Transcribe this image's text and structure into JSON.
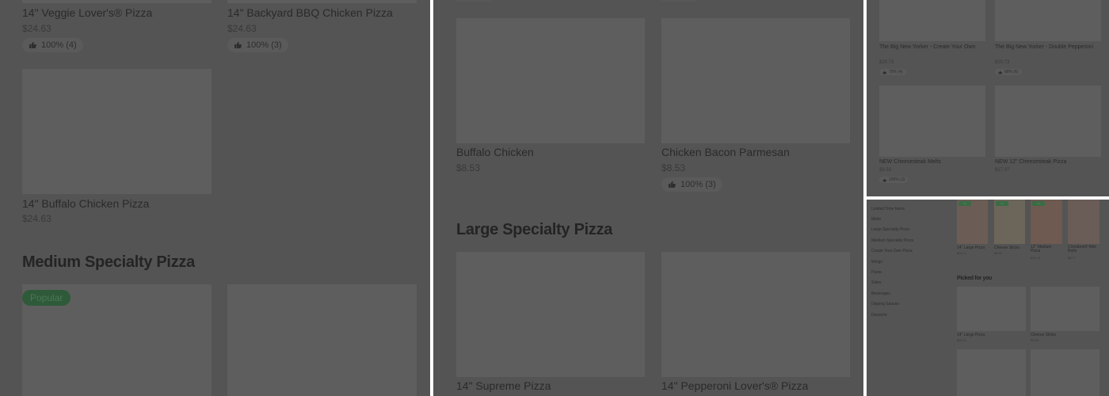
{
  "panel1": {
    "items": [
      {
        "name": "14\" Veggie Lover's® Pizza",
        "price": "$24.63",
        "rating": "100% (4)"
      },
      {
        "name": "14\" Backyard BBQ Chicken Pizza",
        "price": "$24.63",
        "rating": "100% (3)"
      },
      {
        "name": "14\" Buffalo Chicken Pizza",
        "price": "$24.63"
      }
    ],
    "section_title": "Medium Specialty Pizza",
    "popular_badge": "Popular"
  },
  "panel2": {
    "items": [
      {
        "name": "Buffalo Chicken",
        "price": "$8.53"
      },
      {
        "name": "Chicken Bacon Parmesan",
        "price": "$8.53",
        "rating": "100% (3)"
      },
      {
        "name": "14\" Supreme Pizza"
      },
      {
        "name": "14\" Pepperoni Lover's® Pizza"
      }
    ],
    "section_title": "Large Specialty Pizza"
  },
  "panel3": {
    "items": [
      {
        "name": "The Big New Yorker - Create Your Own",
        "price": "$20.73",
        "rating": "75% (4)"
      },
      {
        "name": "The Big New Yorker - Double Pepperoni",
        "price": "$20.73",
        "rating": "68% (6)"
      },
      {
        "name": "NEW Cheesesteak Melts",
        "price": "$8.53",
        "rating": "100% (3)"
      },
      {
        "name": "NEW 12\" Cheesesteak Pizza",
        "price": "$17.07"
      }
    ]
  },
  "panel4": {
    "sidebar": [
      "Limited Time Items",
      "Melts",
      "Large Specialty Pizza",
      "Medium Specialty Pizza",
      "Create Your Own Pizza",
      "Wings",
      "Pasta",
      "Sides",
      "Beverages",
      "Dipping Sauces",
      "Desserts"
    ],
    "tiles": [
      {
        "name": "14\" Large Pizza",
        "price": "$20.11",
        "tag": "#1"
      },
      {
        "name": "Cheese Sticks",
        "price": "$8.53",
        "tag": "#2"
      },
      {
        "name": "12\" Medium Pizza",
        "price": "$15.73",
        "tag": "#3"
      },
      {
        "name": "Cinnabon® Mini Rolls",
        "price": "$6.77"
      }
    ],
    "picked_title": "Picked for you",
    "picked": [
      {
        "name": "14\" Large Pizza",
        "price": "$20.11"
      },
      {
        "name": "Cheese Sticks",
        "price": "$8.53"
      }
    ]
  },
  "colors": {
    "overlay_bg": "#545454",
    "placeholder": "#5e5e5e",
    "badge_green": "#2f5a3a"
  }
}
